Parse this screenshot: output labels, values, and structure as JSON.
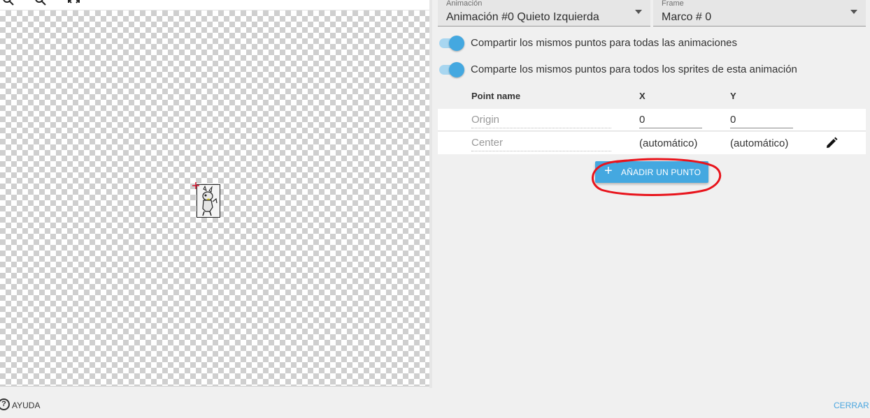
{
  "toolbar": {
    "icons": [
      "zoom-in-icon",
      "zoom-out-icon",
      "fit-to-screen-icon"
    ]
  },
  "animation_select": {
    "label": "Animación",
    "value": "Animación #0 Quieto Izquierda"
  },
  "frame_select": {
    "label": "Frame",
    "value": "Marco # 0"
  },
  "toggles": [
    {
      "label": "Compartir los mismos puntos para todas las animaciones",
      "checked": true
    },
    {
      "label": "Comparte los mismos puntos para todos los sprites de esta animación",
      "checked": true
    }
  ],
  "table": {
    "headers": {
      "name": "Point name",
      "x": "X",
      "y": "Y"
    },
    "rows": [
      {
        "name": "Origin",
        "x": "0",
        "y": "0"
      },
      {
        "name": "Center",
        "x": "(automático)",
        "y": "(automático)"
      }
    ]
  },
  "add_button": {
    "label": "AÑADIR UN PUNTO"
  },
  "footer": {
    "help": "AYUDA",
    "close": "CERRAR"
  },
  "colors": {
    "accent": "#44a8e0",
    "toggle_track": "#a8d6f0",
    "annotation": "#e8141c"
  }
}
